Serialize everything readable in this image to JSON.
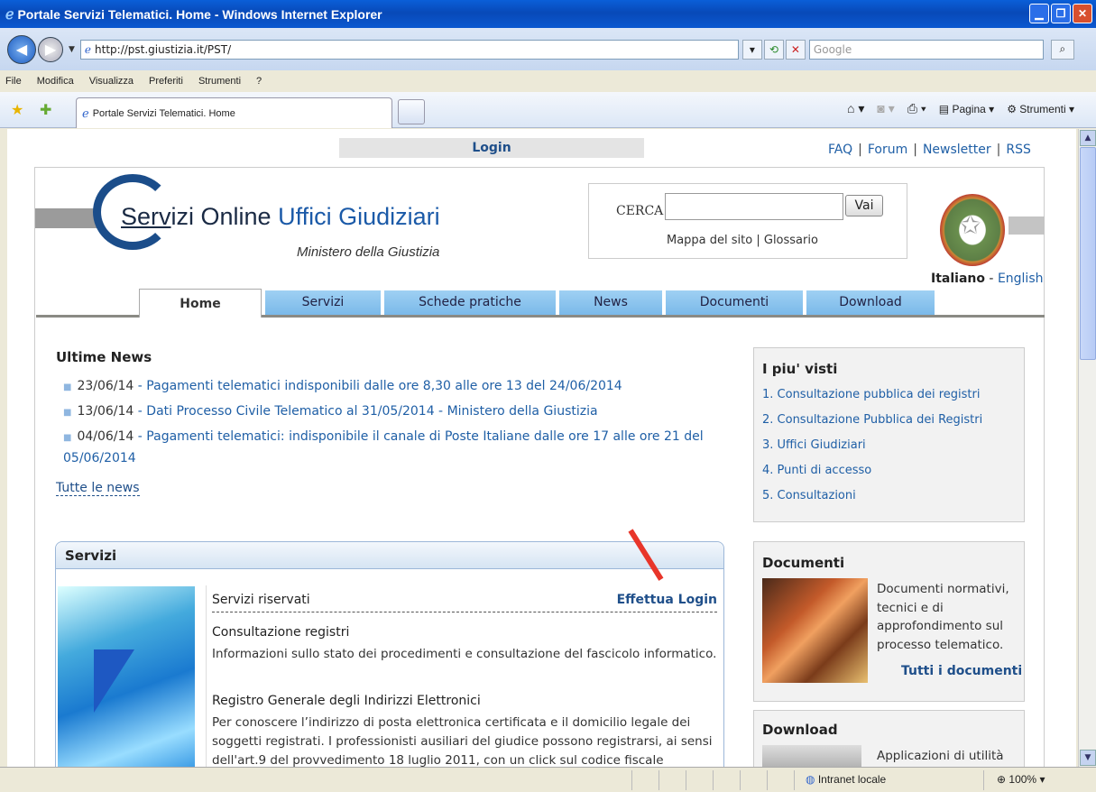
{
  "window": {
    "title": "Portale Servizi Telematici. Home - Windows Internet Explorer"
  },
  "address": {
    "url": "http://pst.giustizia.it/PST/",
    "search_placeholder": "Google"
  },
  "menu": [
    "File",
    "Modifica",
    "Visualizza",
    "Preferiti",
    "Strumenti",
    "?"
  ],
  "tab": {
    "title": "Portale Servizi Telematici. Home"
  },
  "commandbar": {
    "page": "Pagina",
    "tools": "Strumenti"
  },
  "status": {
    "zone": "Intranet locale",
    "zoom": "100%"
  },
  "site": {
    "login": "Login",
    "toplinks": [
      "FAQ",
      "Forum",
      "Newsletter",
      "RSS"
    ],
    "logo_title_part1": "Serv",
    "logo_title_part2": "izi Online ",
    "logo_title_part3": "Uffici Giudiziari",
    "ministero": "Ministero della Giustizia",
    "search_label": "CERCA",
    "search_button": "Vai",
    "mappa": "Mappa del sito",
    "glossario": "Glossario",
    "lang_it": "Italiano",
    "lang_en": "English",
    "nav": [
      "Home",
      "Servizi",
      "Schede pratiche",
      "News",
      "Documenti",
      "Download"
    ]
  },
  "news": {
    "title": "Ultime News",
    "items": [
      {
        "date": "23/06/14",
        "text": "Pagamenti telematici indisponibili dalle ore 8,30 alle ore 13 del 24/06/2014"
      },
      {
        "date": "13/06/14",
        "text": "Dati Processo Civile Telematico al 31/05/2014 - Ministero della Giustizia"
      },
      {
        "date": "04/06/14",
        "text": "Pagamenti telematici: indisponibile il canale di Poste Italiane dalle ore 17 alle ore 21 del 05/06/2014"
      }
    ],
    "all": "Tutte le news"
  },
  "piu_visti": {
    "title": "I piu' visti",
    "items": [
      "1. Consultazione pubblica dei registri",
      "2. Consultazione Pubblica dei Registri",
      "3. Uffici Giudiziari",
      "4. Punti di accesso",
      "5. Consultazioni"
    ]
  },
  "servizi": {
    "title": "Servizi",
    "riservati": "Servizi riservati",
    "login_link": "Effettua Login",
    "s1_title": "Consultazione registri",
    "s1_text": "Informazioni sullo stato dei procedimenti e consultazione del fascicolo informatico.",
    "s2_title": "Registro Generale degli Indirizzi Elettronici",
    "s2_text": "Per conoscere l’indirizzo di posta elettronica certificata e il domicilio legale dei soggetti registrati. I professionisti ausiliari del giudice possono registrarsi, ai sensi dell'art.9 del provvedimento 18 luglio 2011, con un click sul codice fiscale"
  },
  "documenti": {
    "title": "Documenti",
    "text": "Documenti normativi, tecnici e di approfondimento sul processo telematico.",
    "link": "Tutti i documenti"
  },
  "download": {
    "title": "Download",
    "text": "Applicazioni di utilità"
  }
}
